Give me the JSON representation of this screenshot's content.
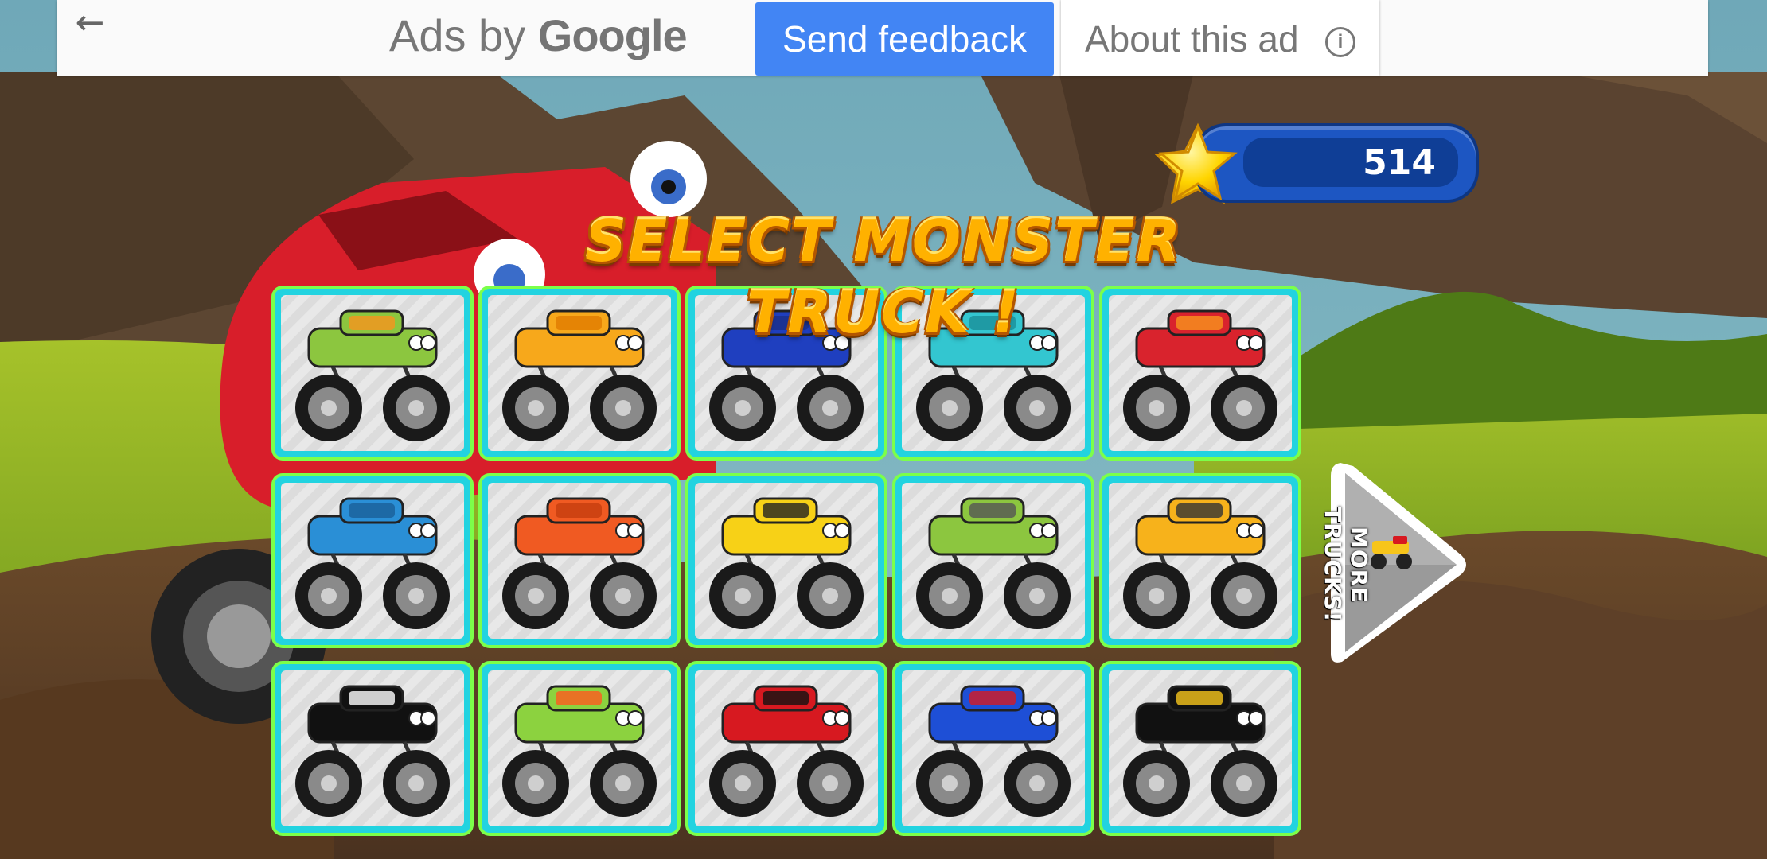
{
  "ad_bar": {
    "back_icon": "arrow-left-icon",
    "ads_by": "Ads by",
    "google": "Google",
    "send_feedback": "Send feedback",
    "about_this_ad": "About this ad",
    "info_icon": "info-icon"
  },
  "hud": {
    "star_icon": "star-icon",
    "score": "514"
  },
  "title": "SELECT MONSTER TRUCK !",
  "more_trucks": "MORE TRUCKS!",
  "trucks": [
    {
      "name": "green-pickup",
      "body": "#8cc63f",
      "accent": "#f7931e"
    },
    {
      "name": "yellow-sedan",
      "body": "#f7a81b",
      "accent": "#e07b00"
    },
    {
      "name": "blue-suv",
      "body": "#1f3fbf",
      "accent": "#1a2f8a"
    },
    {
      "name": "teal-classic",
      "body": "#33c6d0",
      "accent": "#1a8f99"
    },
    {
      "name": "red-fire-suv",
      "body": "#d9232d",
      "accent": "#f7941d"
    },
    {
      "name": "blue-pickup",
      "body": "#2a8fd6",
      "accent": "#1a5f99"
    },
    {
      "name": "orange-beetle",
      "body": "#f05a22",
      "accent": "#c63d0f"
    },
    {
      "name": "yellow-taxi",
      "body": "#f7d117",
      "accent": "#222222"
    },
    {
      "name": "green-flatbed",
      "body": "#8cc63f",
      "accent": "#555555"
    },
    {
      "name": "yellow-bus",
      "body": "#f7b21b",
      "accent": "#333333"
    },
    {
      "name": "police-car",
      "body": "#111111",
      "accent": "#ffffff"
    },
    {
      "name": "rainbow-flame",
      "body": "#8cd23f",
      "accent": "#ff5a1f"
    },
    {
      "name": "spider-red",
      "body": "#d71920",
      "accent": "#111111"
    },
    {
      "name": "super-blue",
      "body": "#1e4fd6",
      "accent": "#d71920"
    },
    {
      "name": "bat-black",
      "body": "#111111",
      "accent": "#f7c51b"
    }
  ]
}
